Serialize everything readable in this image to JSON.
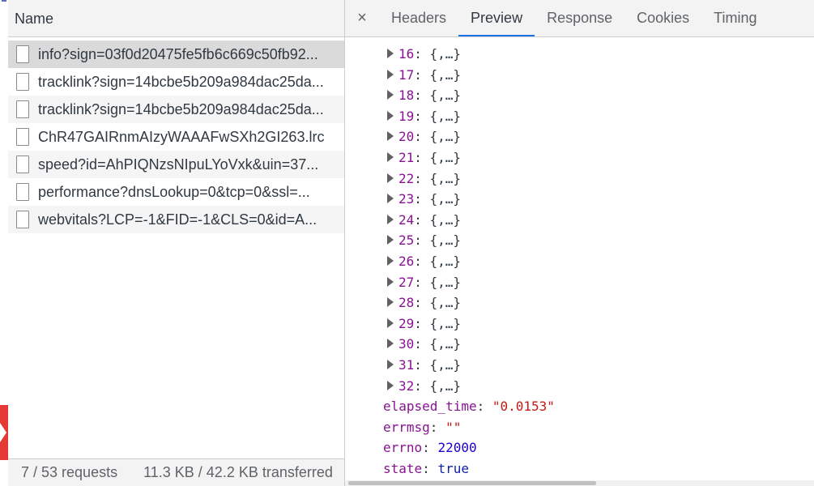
{
  "left": {
    "column_header": "Name",
    "requests": [
      "info?sign=03f0d20475fe5fb6c669c50fb92...",
      "tracklink?sign=14bcbe5b209a984dac25da...",
      "tracklink?sign=14bcbe5b209a984dac25da...",
      "ChR47GAIRnmAIzyWAAAFwSXh2GI263.lrc",
      "speed?id=AhPIQNzsNIpuLYoVxk&uin=37...",
      "performance?dnsLookup=0&tcp=0&ssl=...",
      "webvitals?LCP=-1&FID=-1&CLS=0&id=A..."
    ],
    "status": {
      "requests": "7 / 53 requests",
      "transferred": "11.3 KB / 42.2 KB transferred"
    }
  },
  "right": {
    "close_glyph": "×",
    "tabs": [
      "Headers",
      "Preview",
      "Response",
      "Cookies",
      "Timing"
    ],
    "active_tab": "Preview",
    "tree_items": [
      {
        "key": "16",
        "value": "{,…}"
      },
      {
        "key": "17",
        "value": "{,…}"
      },
      {
        "key": "18",
        "value": "{,…}"
      },
      {
        "key": "19",
        "value": "{,…}"
      },
      {
        "key": "20",
        "value": "{,…}"
      },
      {
        "key": "21",
        "value": "{,…}"
      },
      {
        "key": "22",
        "value": "{,…}"
      },
      {
        "key": "23",
        "value": "{,…}"
      },
      {
        "key": "24",
        "value": "{,…}"
      },
      {
        "key": "25",
        "value": "{,…}"
      },
      {
        "key": "26",
        "value": "{,…}"
      },
      {
        "key": "27",
        "value": "{,…}"
      },
      {
        "key": "28",
        "value": "{,…}"
      },
      {
        "key": "29",
        "value": "{,…}"
      },
      {
        "key": "30",
        "value": "{,…}"
      },
      {
        "key": "31",
        "value": "{,…}"
      },
      {
        "key": "32",
        "value": "{,…}"
      }
    ],
    "properties": [
      {
        "key": "elapsed_time",
        "value": "\"0.0153\"",
        "kind": "str"
      },
      {
        "key": "errmsg",
        "value": "\"\"",
        "kind": "str"
      },
      {
        "key": "errno",
        "value": "22000",
        "kind": "num"
      },
      {
        "key": "state",
        "value": "true",
        "kind": "bool"
      }
    ]
  }
}
